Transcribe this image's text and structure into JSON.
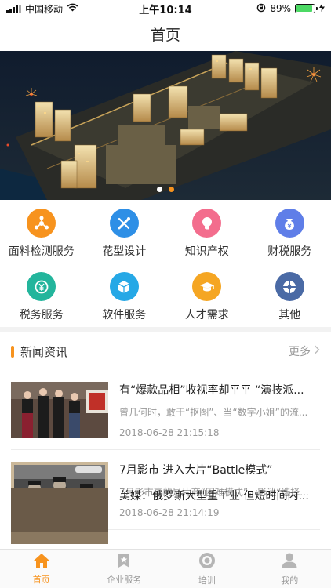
{
  "status_bar": {
    "carrier": "中国移动",
    "time": "上午10:14",
    "battery": "89%",
    "battery_level": 0.89
  },
  "nav": {
    "title": "首页"
  },
  "banner": {
    "slide_count": 2,
    "active_slide": 2
  },
  "services": [
    {
      "label": "面料检测服务",
      "icon": "hub-icon",
      "color": "#f7931e"
    },
    {
      "label": "花型设计",
      "icon": "design-tools-icon",
      "color": "#2e8fe6"
    },
    {
      "label": "知识产权",
      "icon": "lightbulb-icon",
      "color": "#f36d8d"
    },
    {
      "label": "财税服务",
      "icon": "money-bag-icon",
      "color": "#5f7ee8"
    },
    {
      "label": "税务服务",
      "icon": "yuan-coin-icon",
      "color": "#23b59c"
    },
    {
      "label": "软件服务",
      "icon": "cube-icon",
      "color": "#26a8e6"
    },
    {
      "label": "人才需求",
      "icon": "graduation-cap-icon",
      "color": "#f5a623"
    },
    {
      "label": "其他",
      "icon": "grid-icon",
      "color": "#4a6aa5"
    }
  ],
  "news": {
    "title": "新闻资讯",
    "more": "更多",
    "items": [
      {
        "title": "有“爆款品相”收视率却平平 “演技派...",
        "summary": "曾几何时，敢于“抠图”、当“数字小姐”的流...",
        "time": "2018-06-28 21:15:18"
      },
      {
        "title": "7月影市 进入大片“Battle模式”",
        "summary": "7月影市真的是片商“困难模式”，影迷“选择...",
        "time": "2018-06-28 21:14:19"
      },
      {
        "title": "美媒：俄罗斯大型重工业 但短时间内...",
        "summary": "",
        "time": ""
      }
    ]
  },
  "tabs": [
    {
      "label": "首页",
      "icon": "home-icon",
      "active": true
    },
    {
      "label": "企业服务",
      "icon": "bookmark-icon",
      "active": false
    },
    {
      "label": "培训",
      "icon": "target-icon",
      "active": false
    },
    {
      "label": "我的",
      "icon": "user-icon",
      "active": false
    }
  ],
  "colors": {
    "accent": "#f7931e",
    "inactive": "#999999"
  }
}
